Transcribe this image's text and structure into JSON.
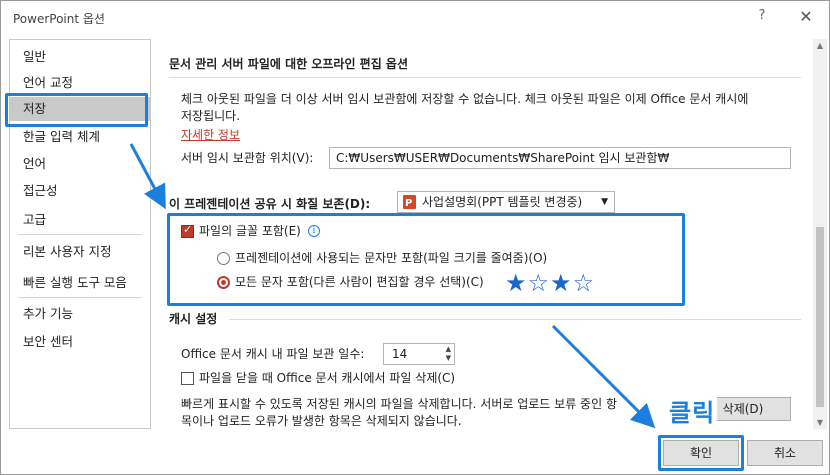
{
  "window": {
    "title": "PowerPoint 옵션",
    "help_label": "?",
    "close_label": "✕"
  },
  "sidebar": {
    "items": [
      {
        "label": "일반"
      },
      {
        "label": "언어 교정"
      },
      {
        "label": "저장"
      },
      {
        "label": "한글 입력 체계"
      },
      {
        "label": "언어"
      },
      {
        "label": "접근성"
      },
      {
        "label": "고급"
      },
      {
        "label": "리본 사용자 지정"
      },
      {
        "label": "빠른 실행 도구 모음"
      },
      {
        "label": "추가 기능"
      },
      {
        "label": "보안 센터"
      }
    ],
    "selected": "저장"
  },
  "offline": {
    "title": "문서 관리 서버 파일에 대한 오프라인 편집 옵션",
    "desc_line1": "체크 아웃된 파일을 더 이상 서버 임시 보관함에 저장할 수 없습니다. 체크 아웃된 파일은 이제 Office 문서 캐시에",
    "desc_line2": "저장됩니다.",
    "more_info_link": "자세한 정보",
    "drafts_label": "서버 임시 보관함 위치(V):",
    "drafts_value": "C:₩Users₩USER₩Documents₩SharePoint 임시 보관함₩"
  },
  "fidelity": {
    "label": "이 프레젠테이션 공유 시 화질 보존(D):",
    "file_icon": "powerpoint-file-icon",
    "selected_file": "사업설명회(PPT 템플릿 변경중)",
    "embed_fonts_label": "파일의 글꼴 포함(E)",
    "info_icon_glyph": "i",
    "option_subset_label": "프레젠테이션에 사용되는 문자만 포함(파일 크기를 줄여줌)(O)",
    "option_all_label": "모든 문자 포함(다른 사람이 편집할 경우 선택)(C)",
    "embed_fonts_checked": true,
    "selected_option": "all",
    "stars": "★☆★☆",
    "star_color": "#1c66d0"
  },
  "cache": {
    "title": "캐시 설정",
    "days_label": "Office 문서 캐시 내 파일 보관 일수:",
    "days_value": "14",
    "delete_on_close_label": "파일을 닫을 때 Office 문서 캐시에서 파일 삭제(C)",
    "delete_on_close_checked": false,
    "info_line1": "빠르게 표시할 수 있도록 저장된 캐시의 파일을 삭제합니다. 서버로 업로드 보류 중인 항",
    "info_line2": "목이나 업로드 오류가 발생한 항목은 삭제되지 않습니다.",
    "delete_button_label": "캐시된 파일 삭제(D)",
    "delete_button_label_visible": "삭제(D)"
  },
  "footer": {
    "ok_label": "확인",
    "cancel_label": "취소"
  },
  "annotations": {
    "click_text": "클릭",
    "highlight_color": "#1c7fe0"
  }
}
